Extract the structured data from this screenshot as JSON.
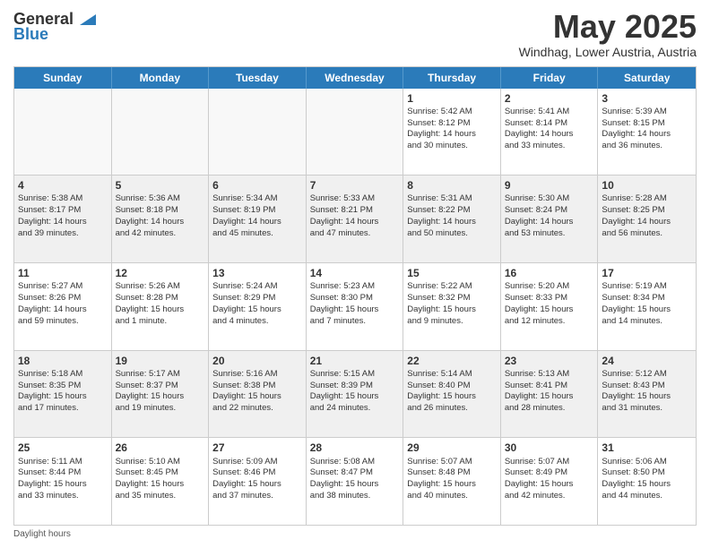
{
  "logo": {
    "general": "General",
    "blue": "Blue"
  },
  "title": "May 2025",
  "location": "Windhag, Lower Austria, Austria",
  "days": [
    "Sunday",
    "Monday",
    "Tuesday",
    "Wednesday",
    "Thursday",
    "Friday",
    "Saturday"
  ],
  "footer": "Daylight hours",
  "weeks": [
    [
      {
        "day": "",
        "info": ""
      },
      {
        "day": "",
        "info": ""
      },
      {
        "day": "",
        "info": ""
      },
      {
        "day": "",
        "info": ""
      },
      {
        "day": "1",
        "info": "Sunrise: 5:42 AM\nSunset: 8:12 PM\nDaylight: 14 hours\nand 30 minutes."
      },
      {
        "day": "2",
        "info": "Sunrise: 5:41 AM\nSunset: 8:14 PM\nDaylight: 14 hours\nand 33 minutes."
      },
      {
        "day": "3",
        "info": "Sunrise: 5:39 AM\nSunset: 8:15 PM\nDaylight: 14 hours\nand 36 minutes."
      }
    ],
    [
      {
        "day": "4",
        "info": "Sunrise: 5:38 AM\nSunset: 8:17 PM\nDaylight: 14 hours\nand 39 minutes."
      },
      {
        "day": "5",
        "info": "Sunrise: 5:36 AM\nSunset: 8:18 PM\nDaylight: 14 hours\nand 42 minutes."
      },
      {
        "day": "6",
        "info": "Sunrise: 5:34 AM\nSunset: 8:19 PM\nDaylight: 14 hours\nand 45 minutes."
      },
      {
        "day": "7",
        "info": "Sunrise: 5:33 AM\nSunset: 8:21 PM\nDaylight: 14 hours\nand 47 minutes."
      },
      {
        "day": "8",
        "info": "Sunrise: 5:31 AM\nSunset: 8:22 PM\nDaylight: 14 hours\nand 50 minutes."
      },
      {
        "day": "9",
        "info": "Sunrise: 5:30 AM\nSunset: 8:24 PM\nDaylight: 14 hours\nand 53 minutes."
      },
      {
        "day": "10",
        "info": "Sunrise: 5:28 AM\nSunset: 8:25 PM\nDaylight: 14 hours\nand 56 minutes."
      }
    ],
    [
      {
        "day": "11",
        "info": "Sunrise: 5:27 AM\nSunset: 8:26 PM\nDaylight: 14 hours\nand 59 minutes."
      },
      {
        "day": "12",
        "info": "Sunrise: 5:26 AM\nSunset: 8:28 PM\nDaylight: 15 hours\nand 1 minute."
      },
      {
        "day": "13",
        "info": "Sunrise: 5:24 AM\nSunset: 8:29 PM\nDaylight: 15 hours\nand 4 minutes."
      },
      {
        "day": "14",
        "info": "Sunrise: 5:23 AM\nSunset: 8:30 PM\nDaylight: 15 hours\nand 7 minutes."
      },
      {
        "day": "15",
        "info": "Sunrise: 5:22 AM\nSunset: 8:32 PM\nDaylight: 15 hours\nand 9 minutes."
      },
      {
        "day": "16",
        "info": "Sunrise: 5:20 AM\nSunset: 8:33 PM\nDaylight: 15 hours\nand 12 minutes."
      },
      {
        "day": "17",
        "info": "Sunrise: 5:19 AM\nSunset: 8:34 PM\nDaylight: 15 hours\nand 14 minutes."
      }
    ],
    [
      {
        "day": "18",
        "info": "Sunrise: 5:18 AM\nSunset: 8:35 PM\nDaylight: 15 hours\nand 17 minutes."
      },
      {
        "day": "19",
        "info": "Sunrise: 5:17 AM\nSunset: 8:37 PM\nDaylight: 15 hours\nand 19 minutes."
      },
      {
        "day": "20",
        "info": "Sunrise: 5:16 AM\nSunset: 8:38 PM\nDaylight: 15 hours\nand 22 minutes."
      },
      {
        "day": "21",
        "info": "Sunrise: 5:15 AM\nSunset: 8:39 PM\nDaylight: 15 hours\nand 24 minutes."
      },
      {
        "day": "22",
        "info": "Sunrise: 5:14 AM\nSunset: 8:40 PM\nDaylight: 15 hours\nand 26 minutes."
      },
      {
        "day": "23",
        "info": "Sunrise: 5:13 AM\nSunset: 8:41 PM\nDaylight: 15 hours\nand 28 minutes."
      },
      {
        "day": "24",
        "info": "Sunrise: 5:12 AM\nSunset: 8:43 PM\nDaylight: 15 hours\nand 31 minutes."
      }
    ],
    [
      {
        "day": "25",
        "info": "Sunrise: 5:11 AM\nSunset: 8:44 PM\nDaylight: 15 hours\nand 33 minutes."
      },
      {
        "day": "26",
        "info": "Sunrise: 5:10 AM\nSunset: 8:45 PM\nDaylight: 15 hours\nand 35 minutes."
      },
      {
        "day": "27",
        "info": "Sunrise: 5:09 AM\nSunset: 8:46 PM\nDaylight: 15 hours\nand 37 minutes."
      },
      {
        "day": "28",
        "info": "Sunrise: 5:08 AM\nSunset: 8:47 PM\nDaylight: 15 hours\nand 38 minutes."
      },
      {
        "day": "29",
        "info": "Sunrise: 5:07 AM\nSunset: 8:48 PM\nDaylight: 15 hours\nand 40 minutes."
      },
      {
        "day": "30",
        "info": "Sunrise: 5:07 AM\nSunset: 8:49 PM\nDaylight: 15 hours\nand 42 minutes."
      },
      {
        "day": "31",
        "info": "Sunrise: 5:06 AM\nSunset: 8:50 PM\nDaylight: 15 hours\nand 44 minutes."
      }
    ]
  ]
}
